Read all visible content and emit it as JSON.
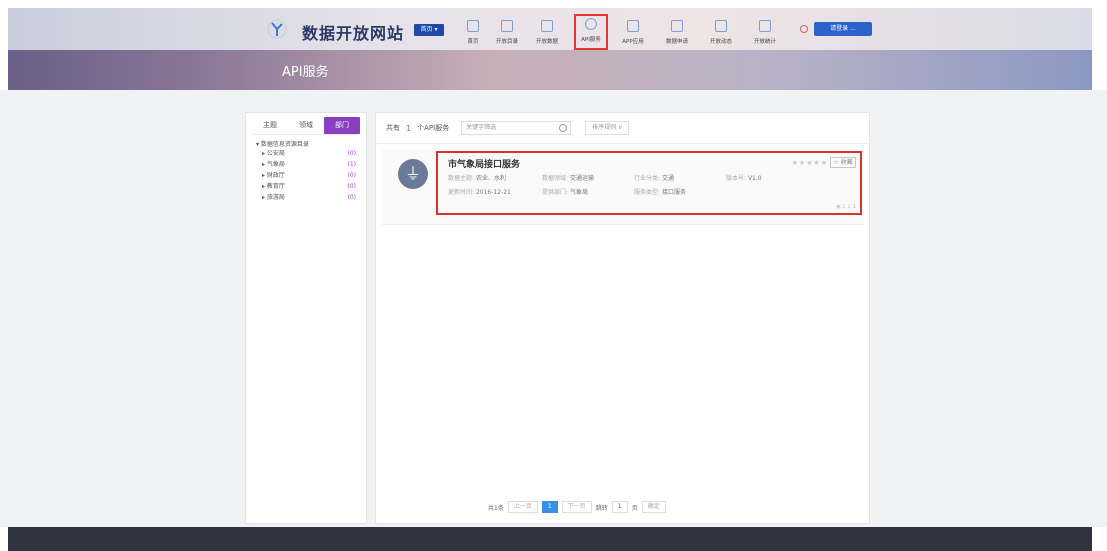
{
  "header": {
    "site_title": "数据开放网站",
    "region_badge": "首页 ▾",
    "nav": [
      {
        "label": "首页",
        "icon": "home-icon"
      },
      {
        "label": "开放目录",
        "icon": "catalog-icon"
      },
      {
        "label": "开放数据",
        "icon": "database-icon"
      },
      {
        "label": "API服务",
        "icon": "api-icon",
        "active": true
      },
      {
        "label": "APP应用",
        "icon": "apps-icon"
      },
      {
        "label": "数据申请",
        "icon": "apply-icon"
      },
      {
        "label": "开放动态",
        "icon": "news-icon"
      },
      {
        "label": "开放统计",
        "icon": "stats-icon"
      }
    ],
    "login_label": "请登录 ..."
  },
  "banner": {
    "title": "API服务"
  },
  "sidebar": {
    "tabs": [
      {
        "label": "主题",
        "active": false
      },
      {
        "label": "领域",
        "active": false
      },
      {
        "label": "部门",
        "active": true
      }
    ],
    "tree_root": "▾ 数据信息资源目录",
    "items": [
      {
        "label": "▸ 公安局",
        "count": "(0)"
      },
      {
        "label": "▸ 气象局",
        "count": "(1)"
      },
      {
        "label": "▸ 财政厅",
        "count": "(0)"
      },
      {
        "label": "▸ 教育厅",
        "count": "(0)"
      },
      {
        "label": "▸ 旅游局",
        "count": "(0)"
      }
    ]
  },
  "toolbar": {
    "prefix": "共有",
    "count": "1",
    "suffix": "个API服务",
    "search_placeholder": "关键字筛选",
    "sort_label": "排序规则 ∨"
  },
  "service": {
    "icon_glyph": "⏚",
    "name": "市气象局接口服务",
    "rating": "★★★★★",
    "collect_label": "☆ 收藏",
    "meta": {
      "topic_k": "数据主题:",
      "topic_v": "农业、水利",
      "domain_k": "数据领域:",
      "domain_v": "交通运输",
      "industry_k": "行业分类:",
      "industry_v": "交通",
      "version_k": "版本号:",
      "version_v": "V1.0",
      "updated_k": "更新时间:",
      "updated_v": "2016-12-21",
      "dept_k": "提供部门:",
      "dept_v": "气象局",
      "type_k": "服务类型:",
      "type_v": "接口服务"
    },
    "stats": "◉ 1  ⇩ 1"
  },
  "pagination": {
    "total": "共1条",
    "prev": "上一页",
    "current": "1",
    "next": "下一页",
    "goto": "跳转",
    "page_input": "1",
    "page_unit": "页",
    "confirm": "确定"
  }
}
